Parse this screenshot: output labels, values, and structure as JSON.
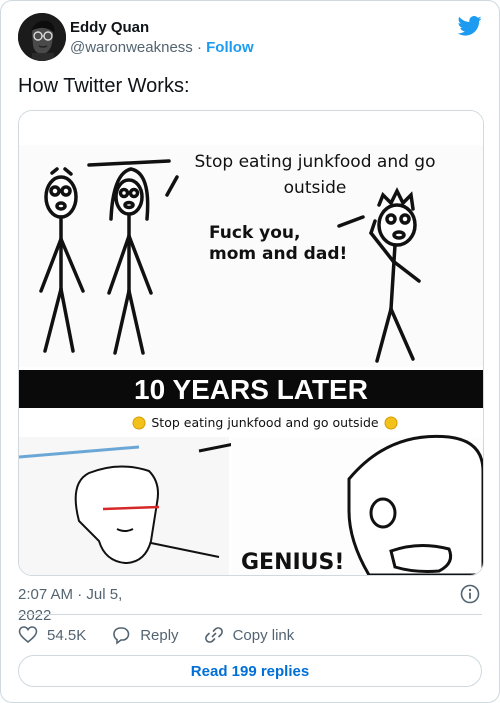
{
  "author": {
    "display_name": "Eddy Quan",
    "handle": "@waronweakness",
    "separator": "·",
    "follow_label": "Follow"
  },
  "tweet": {
    "text": "How Twitter Works:"
  },
  "meme": {
    "panel1_speech": "Stop eating junkfood and go outside",
    "panel1_speech_line1": "Stop eating junkfood and go",
    "panel1_speech_line2": "outside",
    "panel1_reply_line1": "Fuck you,",
    "panel1_reply_line2": "mom and dad!",
    "banner": "10 YEARS LATER",
    "panel2_caption": "Stop eating junkfood and go outside",
    "panel2_reply": "GENIUS!"
  },
  "meta": {
    "time": "2:07 AM",
    "separator": "·",
    "date_part1": "Jul 5,",
    "date_part2": "2022"
  },
  "actions": {
    "likes": "54.5K",
    "reply_label": "Reply",
    "copy_link_label": "Copy link"
  },
  "read_replies_label": "Read 199 replies",
  "colors": {
    "twitter_blue": "#1d9bf0",
    "link_blue": "#006fd6",
    "secondary_text": "#536471",
    "border": "#cfd9de"
  },
  "icons": {
    "brand": "twitter-bird-icon",
    "info": "info-icon",
    "like": "heart-icon",
    "reply": "speech-bubble-icon",
    "copy": "link-icon"
  }
}
